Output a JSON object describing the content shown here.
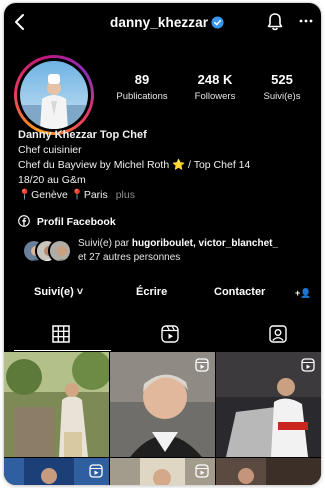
{
  "header": {
    "username": "danny_khezzar",
    "verified": true,
    "icons": [
      "back-arrow-icon",
      "verified-badge-icon",
      "bell-icon",
      "more-options-icon"
    ]
  },
  "stats": [
    {
      "value": "89",
      "label": "Publications"
    },
    {
      "value": "248 K",
      "label": "Followers"
    },
    {
      "value": "525",
      "label": "Suivi(e)s"
    }
  ],
  "bio": {
    "name": "Danny Khezzar Top Chef",
    "category": "Chef cuisinier",
    "line1": "Chef du Bayview by Michel Roth ⭐ /  Top Chef 14",
    "line2": "18/20 au G&m",
    "locations": "📍Genève 📍Paris",
    "more": "plus",
    "facebook_link": "Profil Facebook"
  },
  "followed_by": {
    "prefix": "Suivi(e) par ",
    "names": "hugoriboulet, victor_blanchet_",
    "suffix": "et 27 autres personnes"
  },
  "actions": {
    "follow": "Suivi(e) ˅",
    "message": "Écrire",
    "contact": "Contacter",
    "add_person": "+👤"
  },
  "tabs": [
    "grid-tab",
    "reels-tab",
    "tagged-tab"
  ],
  "colors": {
    "background": "#000000",
    "verified": "#3897f0",
    "muted": "#8e8e8e",
    "ring_start": "#f9a21b",
    "ring_end": "#c2187e"
  }
}
